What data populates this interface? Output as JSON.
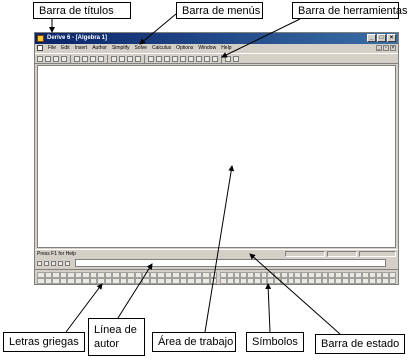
{
  "labels": {
    "title_bar": "Barra de títulos",
    "menu_bar": "Barra de menús",
    "toolbar": "Barra de herramientas",
    "greek_letters": "Letras griegas",
    "author_line": "Línea de autor",
    "work_area": "Área de trabajo",
    "symbols": "Símbolos",
    "status_bar": "Barra de estado"
  },
  "window": {
    "title": "Derive 6 - [Algebra 1]",
    "menus": [
      "File",
      "Edit",
      "Insert",
      "Author",
      "Simplify",
      "Solve",
      "Calculus",
      "Options",
      "Window",
      "Help"
    ],
    "status_text": "Press F1 for Help"
  },
  "colors": {
    "titlebar_start": "#0a246a",
    "titlebar_end": "#3a6ea5",
    "chrome": "#d4d0c8",
    "callout_border": "#000000"
  },
  "icons": {
    "window_buttons": [
      "minimize-icon",
      "maximize-icon",
      "close-icon"
    ]
  }
}
